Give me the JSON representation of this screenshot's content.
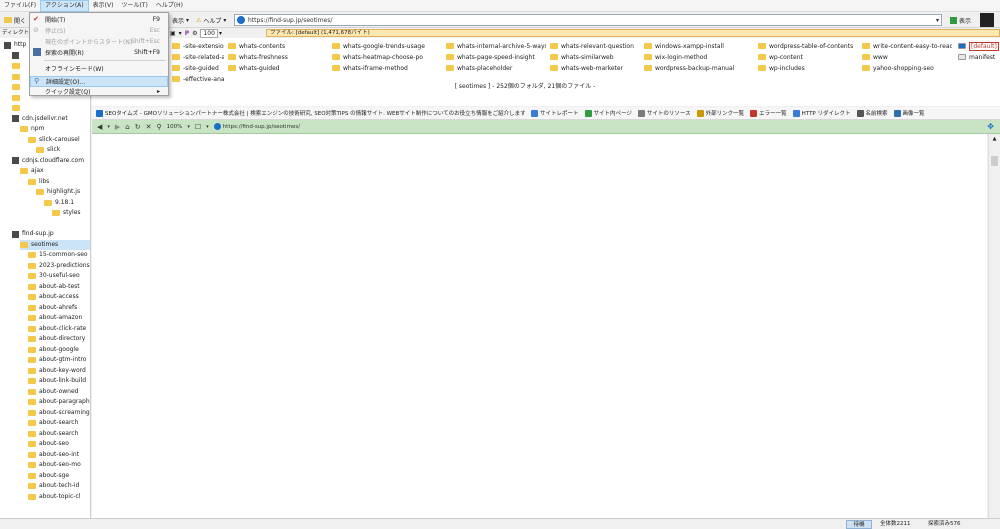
{
  "menubar": {
    "items": [
      "ファイル(F)",
      "アクション(A)",
      "表示(V)",
      "ツール(T)",
      "ヘルプ(H)"
    ]
  },
  "toolbar": {
    "open_label": "開く",
    "view_label": "表示",
    "help_label": "ヘルプ",
    "url": "https://find-sup.jp/seotimes/",
    "show_label": "表示",
    "zoom": "100"
  },
  "row2": {
    "tab_label": "ディレクトリ",
    "filter_text": "ファイル: [default] (1,471,678バイト)"
  },
  "dropdown": {
    "items": [
      {
        "label": "開始(T)",
        "shortcut": "F9",
        "state": "normal"
      },
      {
        "label": "停止(S)",
        "shortcut": "Esc",
        "state": "disabled"
      },
      {
        "label": "現在のポイントからスタート(N)",
        "shortcut": "Shift+Esc",
        "state": "disabled"
      },
      {
        "label": "探索の再開(R)",
        "shortcut": "Shift+F9",
        "state": "normal"
      },
      {
        "label": "オフラインモード(W)",
        "shortcut": "",
        "state": "normal"
      },
      {
        "label": "詳細設定(O)...",
        "shortcut": "",
        "state": "hover"
      },
      {
        "label": "クイック設定(Q)",
        "shortcut": "▸",
        "state": "normal"
      }
    ]
  },
  "tree": {
    "items": [
      {
        "label": "http",
        "type": "pc",
        "indent": 0
      },
      {
        "label": "",
        "type": "pc",
        "indent": 1
      },
      {
        "label": "",
        "type": "folder",
        "indent": 1
      },
      {
        "label": "",
        "type": "folder",
        "indent": 1
      },
      {
        "label": "",
        "type": "folder",
        "indent": 1
      },
      {
        "label": "",
        "type": "folder",
        "indent": 1
      },
      {
        "label": "",
        "type": "folder",
        "indent": 1
      },
      {
        "label": "cdn.jsdelivr.net",
        "type": "pc",
        "indent": 1
      },
      {
        "label": "npm",
        "type": "folder",
        "indent": 2
      },
      {
        "label": "slick-carousel",
        "type": "folder",
        "indent": 3
      },
      {
        "label": "slick",
        "type": "folder",
        "indent": 4
      },
      {
        "label": "cdnjs.cloudflare.com",
        "type": "pc",
        "indent": 1
      },
      {
        "label": "ajax",
        "type": "folder",
        "indent": 2
      },
      {
        "label": "libs",
        "type": "folder",
        "indent": 3
      },
      {
        "label": "highlight.js",
        "type": "folder",
        "indent": 4
      },
      {
        "label": "9.18.1",
        "type": "folder",
        "indent": 5
      },
      {
        "label": "styles",
        "type": "folder",
        "indent": 6
      },
      {
        "label": "",
        "type": "none",
        "indent": 1
      },
      {
        "label": "find-sup.jp",
        "type": "pc",
        "indent": 1
      },
      {
        "label": "seotimes",
        "type": "folder",
        "indent": 2,
        "selected": true
      },
      {
        "label": "15-common-seo",
        "type": "folder",
        "indent": 3
      },
      {
        "label": "2023-predictions",
        "type": "folder",
        "indent": 3
      },
      {
        "label": "30-useful-seo",
        "type": "folder",
        "indent": 3
      },
      {
        "label": "about-ab-test",
        "type": "folder",
        "indent": 3
      },
      {
        "label": "about-access",
        "type": "folder",
        "indent": 3
      },
      {
        "label": "about-ahrefs",
        "type": "folder",
        "indent": 3
      },
      {
        "label": "about-amazon",
        "type": "folder",
        "indent": 3
      },
      {
        "label": "about-click-rate",
        "type": "folder",
        "indent": 3
      },
      {
        "label": "about-directory",
        "type": "folder",
        "indent": 3
      },
      {
        "label": "about-google",
        "type": "folder",
        "indent": 3
      },
      {
        "label": "about-gtm-intro",
        "type": "folder",
        "indent": 3
      },
      {
        "label": "about-key-word",
        "type": "folder",
        "indent": 3
      },
      {
        "label": "about-link-build",
        "type": "folder",
        "indent": 3
      },
      {
        "label": "about-owned",
        "type": "folder",
        "indent": 3
      },
      {
        "label": "about-paragraph",
        "type": "folder",
        "indent": 3
      },
      {
        "label": "about-screaming",
        "type": "folder",
        "indent": 3
      },
      {
        "label": "about-search",
        "type": "folder",
        "indent": 3
      },
      {
        "label": "about-search",
        "type": "folder",
        "indent": 3
      },
      {
        "label": "about-seo",
        "type": "folder",
        "indent": 3
      },
      {
        "label": "about-seo-int",
        "type": "folder",
        "indent": 3
      },
      {
        "label": "about-seo-mo",
        "type": "folder",
        "indent": 3
      },
      {
        "label": "about-sge",
        "type": "folder",
        "indent": 3
      },
      {
        "label": "about-tech-id",
        "type": "folder",
        "indent": 3
      },
      {
        "label": "about-topic-cl",
        "type": "folder",
        "indent": 3
      }
    ]
  },
  "grid": {
    "columns": [
      [
        "-site-extensions",
        "-site-related-area",
        "-site-guided",
        "-effective-analysis"
      ],
      [
        "whats-contents",
        "whats-freshness",
        "whats-guided"
      ],
      [
        "whats-google-trends-usage",
        "whats-heatmap-choose-po",
        "whats-iframe-method"
      ],
      [
        "whats-internal-archive-5-ways",
        "whats-page-speed-insight",
        "whats-placeholder"
      ],
      [
        "whats-relevant-question",
        "whats-similarweb",
        "whats-web-marketer"
      ],
      [
        "windows-xampp-install",
        "wix-login-method",
        "wordpress-backup-manual"
      ],
      [
        "wordpress-table-of-contents",
        "wp-content",
        "wp-includes"
      ],
      [
        "write-content-easy-to-read",
        "www",
        "yahoo-shopping-seo"
      ],
      [
        "[default]",
        "manifest"
      ]
    ],
    "summary": "[ seotimes ] - 252個のフォルダ, 21個のファイル -"
  },
  "bookmarks": {
    "page_title": "SEOタイムズ - GMOソリューションパートナー株式会社 | 検索エンジンの技術研究, SEO対策TIPS の情報サイト. WEBサイト制作についてのお役立ち情報をご紹介します.",
    "items": [
      "サイトレポート",
      "サイト内ページ",
      "サイトのリソース",
      "外部リンク一覧",
      "エラー一覧",
      "HTTP リダイレクト",
      "名前検索",
      "画像一覧"
    ]
  },
  "navbar": {
    "zoom": "100%",
    "url": "https://find-sup.jp/seotimes/"
  },
  "statusbar": {
    "mode": "待機",
    "total": "全体数2211",
    "explored": "探索済み576"
  },
  "colors": {
    "accent": "#1a6fc9",
    "folder": "#f2c94c",
    "nav_green": "#c9e4c4",
    "menu_hover": "#cce4f7"
  }
}
